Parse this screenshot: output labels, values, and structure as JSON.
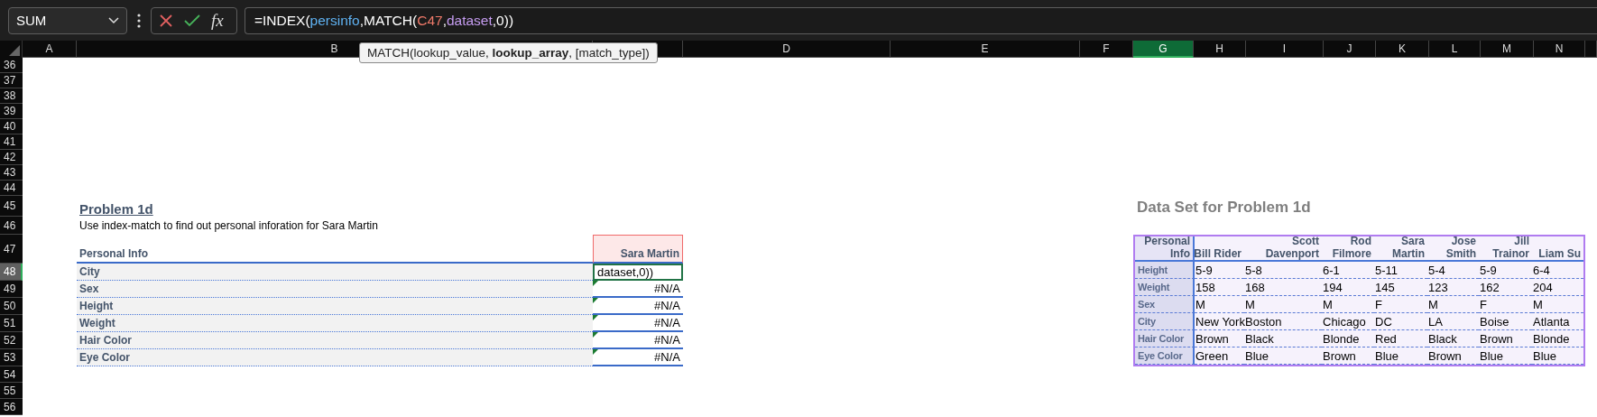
{
  "name_box": {
    "value": "SUM"
  },
  "formula_buttons": {
    "function_label": "fx"
  },
  "formula": [
    {
      "kind": "plain",
      "text": "=INDEX("
    },
    {
      "kind": "ref",
      "text": "persinfo",
      "color": "#5fb2f2"
    },
    {
      "kind": "plain",
      "text": ",MATCH("
    },
    {
      "kind": "ref",
      "text": "C47",
      "color": "#f07a6a"
    },
    {
      "kind": "plain",
      "text": ","
    },
    {
      "kind": "ref",
      "text": "dataset",
      "color": "#c59cf0"
    },
    {
      "kind": "plain",
      "text": ",0))"
    }
  ],
  "tooltip": {
    "text": "MATCH(lookup_value, **lookup_array**, [match_type])"
  },
  "columns": [
    {
      "label": "A",
      "selected": false
    },
    {
      "label": "B",
      "selected": false
    },
    {
      "selected": false
    },
    {
      "label": "D",
      "selected": false
    },
    {
      "label": "E",
      "selected": false
    },
    {
      "label": "F",
      "selected": false
    },
    {
      "label": "G",
      "selected": true
    },
    {
      "label": "H",
      "selected": false
    },
    {
      "label": "I",
      "selected": false
    },
    {
      "label": "J",
      "selected": false
    },
    {
      "label": "K",
      "selected": false
    },
    {
      "label": "L",
      "selected": false
    },
    {
      "label": "M",
      "selected": false
    },
    {
      "label": "N",
      "selected": false
    }
  ],
  "rows": [
    {
      "label": "36",
      "selected": false
    },
    {
      "label": "37",
      "selected": false
    },
    {
      "label": "38",
      "selected": false
    },
    {
      "label": "39",
      "selected": false
    },
    {
      "label": "40",
      "selected": false
    },
    {
      "label": "41",
      "selected": false
    },
    {
      "label": "42",
      "selected": false
    },
    {
      "label": "43",
      "selected": false
    },
    {
      "label": "44",
      "selected": false
    },
    {
      "label": "45",
      "selected": false
    },
    {
      "label": "46",
      "selected": false
    },
    {
      "label": "47",
      "selected": false
    },
    {
      "label": "48",
      "selected": true
    },
    {
      "label": "49",
      "selected": false
    },
    {
      "label": "50",
      "selected": false
    },
    {
      "label": "51",
      "selected": false
    },
    {
      "label": "52",
      "selected": false
    },
    {
      "label": "53",
      "selected": false
    },
    {
      "label": "54",
      "selected": false
    },
    {
      "label": "55",
      "selected": false
    },
    {
      "label": "56",
      "selected": false
    }
  ],
  "problem": {
    "title": "Problem 1d",
    "instruction": "Use index-match to find out personal inforation for Sara Martin",
    "header": {
      "label": "Personal Info",
      "value": "Sara Martin",
      "referenced": true
    },
    "rows": [
      {
        "label": "City",
        "value": "dataset,0))",
        "kind": "editing"
      },
      {
        "label": "Sex",
        "value": "#N/A",
        "kind": "error"
      },
      {
        "label": "Height",
        "value": "#N/A",
        "kind": "error"
      },
      {
        "label": "Weight",
        "value": "#N/A",
        "kind": "error"
      },
      {
        "label": "Hair Color",
        "value": "#N/A",
        "kind": "error"
      },
      {
        "label": "Eye Color",
        "value": "#N/A",
        "kind": "error"
      }
    ]
  },
  "dataset": {
    "title": "Data Set for Problem 1d",
    "header_label": [
      "Personal",
      "Info"
    ],
    "people": [
      {
        "lines": [
          "Bill Rider"
        ]
      },
      {
        "lines": [
          "Scott",
          "Davenport"
        ]
      },
      {
        "lines": [
          "Rod",
          "Filmore"
        ]
      },
      {
        "lines": [
          "Sara",
          "Martin"
        ]
      },
      {
        "lines": [
          "Jose",
          "Smith"
        ]
      },
      {
        "lines": [
          "Jill",
          "Trainor"
        ]
      },
      {
        "lines": [
          "Liam Su"
        ]
      }
    ],
    "rows": [
      {
        "label": "Height",
        "values": [
          "5-9",
          "5-8",
          "6-1",
          "5-11",
          "5-4",
          "5-9",
          "6-4"
        ]
      },
      {
        "label": "Weight",
        "values": [
          "158",
          "168",
          "194",
          "145",
          "123",
          "162",
          "204"
        ]
      },
      {
        "label": "Sex",
        "values": [
          "M",
          "M",
          "M",
          "F",
          "M",
          "F",
          "M"
        ]
      },
      {
        "label": "City",
        "values": [
          "New York",
          "Boston",
          "Chicago",
          "DC",
          "LA",
          "Boise",
          "Atlanta"
        ]
      },
      {
        "label": "Hair Color",
        "values": [
          "Brown",
          "Black",
          "Blonde",
          "Red",
          "Black",
          "Brown",
          "Blonde"
        ]
      },
      {
        "label": "Eye Color",
        "values": [
          "Green",
          "Blue",
          "Brown",
          "Blue",
          "Brown",
          "Blue",
          "Blue"
        ]
      }
    ]
  }
}
